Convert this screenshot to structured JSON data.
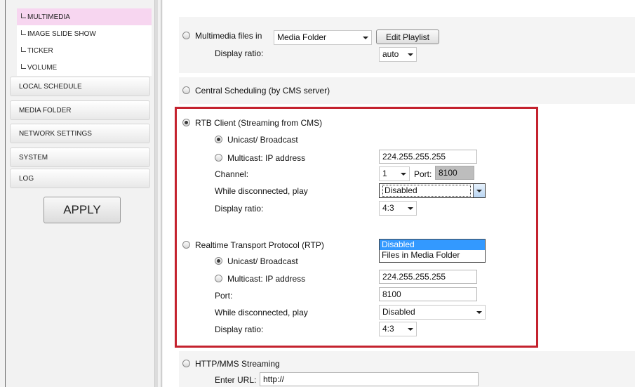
{
  "sidebar": {
    "subitems": [
      {
        "label": "MULTIMEDIA",
        "active": true
      },
      {
        "label": "IMAGE SLIDE SHOW",
        "active": false
      },
      {
        "label": "TICKER",
        "active": false
      },
      {
        "label": "VOLUME",
        "active": false
      }
    ],
    "items": [
      "LOCAL SCHEDULE",
      "MEDIA FOLDER",
      "NETWORK SETTINGS",
      "SYSTEM",
      "LOG"
    ],
    "apply_label": "APPLY"
  },
  "multimedia": {
    "label": "Multimedia files in",
    "folder_value": "Media Folder",
    "edit_button": "Edit Playlist",
    "ratio_label": "Display ratio:",
    "ratio_value": "auto"
  },
  "central": {
    "label": "Central Scheduling (by CMS server)"
  },
  "rtb": {
    "label": "RTB Client (Streaming from CMS)",
    "unicast_label": "Unicast/ Broadcast",
    "multicast_label": "Multicast: IP address",
    "ip_value": "224.255.255.255",
    "channel_label": "Channel:",
    "channel_value": "1",
    "port_label": "Port:",
    "port_value": "8100",
    "disconnected_label": "While disconnected, play",
    "disconnected_value": "Disabled",
    "ratio_label": "Display ratio:",
    "ratio_value": "4:3"
  },
  "dropdown_options": [
    "Disabled",
    "Files in Media Folder"
  ],
  "rtp": {
    "label": "Realtime Transport Protocol (RTP)",
    "unicast_label": "Unicast/ Broadcast",
    "multicast_label": "Multicast: IP address",
    "ip_value": "224.255.255.255",
    "port_label": "Port:",
    "port_value": "8100",
    "disconnected_label": "While disconnected, play",
    "disconnected_value": "Disabled",
    "ratio_label": "Display ratio:",
    "ratio_value": "4:3"
  },
  "http": {
    "label": "HTTP/MMS Streaming",
    "url_label": "Enter URL:",
    "url_value": "http://"
  },
  "colors": {
    "highlight_box": "#c4222e",
    "active_item": "#f7d6f0",
    "dropdown_selected": "#3399ff"
  }
}
